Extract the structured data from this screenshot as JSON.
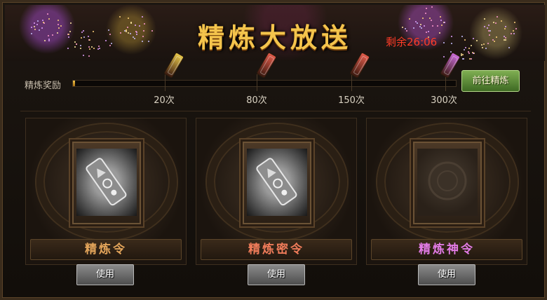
{
  "banner": {
    "title": "精炼大放送",
    "countdown": "剩余26:06"
  },
  "progress": {
    "label": "精炼奖励",
    "fraction": 0.0,
    "milestones": [
      {
        "label": "20次",
        "rod_color": "#e8c84a",
        "icon": "yellow-refine-rod-icon"
      },
      {
        "label": "80次",
        "rod_color": "#e05a4a",
        "icon": "red-refine-rod-icon"
      },
      {
        "label": "150次",
        "rod_color": "#e05a4a",
        "icon": "red-refine-rod-icon"
      },
      {
        "label": "300次",
        "rod_color": "#c86ad8",
        "icon": "purple-refine-rod-icon"
      }
    ],
    "goto_button": "前往精炼"
  },
  "cards": [
    {
      "name": "精炼令",
      "name_color": "#e2a45a",
      "has_item": true,
      "use_label": "使用"
    },
    {
      "name": "精炼密令",
      "name_color": "#f07c5a",
      "has_item": true,
      "use_label": "使用"
    },
    {
      "name": "精炼神令",
      "name_color": "#e27be6",
      "has_item": false,
      "use_label": "使用"
    }
  ],
  "colors": {
    "title": "#f4c44c",
    "countdown": "#ff3c28",
    "goto_button": "#5a8c3a"
  }
}
